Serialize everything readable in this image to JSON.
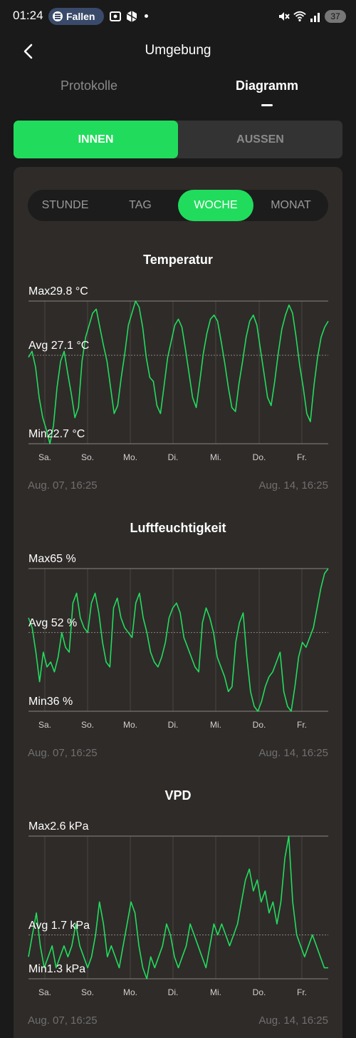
{
  "status_bar": {
    "time": "01:24",
    "media_app": "Fallen",
    "battery": "37"
  },
  "header": {
    "title": "Umgebung",
    "back_icon": "chevron-left-icon"
  },
  "tabs": [
    {
      "label": "Protokolle",
      "active": false
    },
    {
      "label": "Diagramm",
      "active": true
    }
  ],
  "location_toggle": [
    {
      "label": "INNEN",
      "active": true
    },
    {
      "label": "AUSSEN",
      "active": false
    }
  ],
  "time_range": [
    {
      "label": "STUNDE",
      "active": false
    },
    {
      "label": "TAG",
      "active": false
    },
    {
      "label": "WOCHE",
      "active": true
    },
    {
      "label": "MONAT",
      "active": false
    }
  ],
  "colors": {
    "accent": "#21dc5c",
    "background": "#1a1a1a",
    "card": "#2f2b29"
  },
  "chart_data": [
    {
      "type": "line",
      "title": "Temperatur",
      "max_label": "Max29.8 °C",
      "avg_label": "Avg 27.1 °C",
      "min_label": "Min22.7 °C",
      "ylim": [
        22.7,
        29.8
      ],
      "avg": 27.1,
      "x_tick_labels": [
        "Sa.",
        "So.",
        "Mo.",
        "Di.",
        "Mi.",
        "Do.",
        "Fr."
      ],
      "start_label": "Aug. 07, 16:25",
      "end_label": "Aug. 14, 16:25",
      "series": [
        {
          "values": [
            27.0,
            27.3,
            26.5,
            25.0,
            24.0,
            23.4,
            22.7,
            23.6,
            25.5,
            26.8,
            27.3,
            26.2,
            25.2,
            24.0,
            24.5,
            26.8,
            28.0,
            28.6,
            29.2,
            29.4,
            28.5,
            27.6,
            26.8,
            25.5,
            24.2,
            24.6,
            26.0,
            27.2,
            28.6,
            29.2,
            29.8,
            29.5,
            28.5,
            27.0,
            26.0,
            25.8,
            24.6,
            24.2,
            25.6,
            27.0,
            27.8,
            28.6,
            28.9,
            28.5,
            27.4,
            26.2,
            25.0,
            24.5,
            25.8,
            27.2,
            28.2,
            28.9,
            29.1,
            28.8,
            27.8,
            26.7,
            25.5,
            24.5,
            24.3,
            25.7,
            26.8,
            28.0,
            28.8,
            29.1,
            28.6,
            27.4,
            26.2,
            25.0,
            24.6,
            25.8,
            27.2,
            28.4,
            29.1,
            29.6,
            29.2,
            28.0,
            26.6,
            25.5,
            24.2,
            23.8,
            25.6,
            27.0,
            28.0,
            28.5,
            28.8
          ]
        }
      ]
    },
    {
      "type": "line",
      "title": "Luftfeuchtigkeit",
      "max_label": "Max65 %",
      "avg_label": "Avg 52 %",
      "min_label": "Min36 %",
      "ylim": [
        36,
        65
      ],
      "avg": 52,
      "x_tick_labels": [
        "Sa.",
        "So.",
        "Mo.",
        "Di.",
        "Mi.",
        "Do.",
        "Fr."
      ],
      "start_label": "Aug. 07, 16:25",
      "end_label": "Aug. 14, 16:25",
      "series": [
        {
          "values": [
            55,
            53,
            48,
            42,
            48,
            45,
            46,
            44,
            47,
            52,
            49,
            48,
            58,
            60,
            55,
            53,
            52,
            58,
            60,
            56,
            50,
            46,
            45,
            57,
            59,
            55,
            53,
            52,
            51,
            58,
            60,
            55,
            52,
            48,
            46,
            45,
            47,
            50,
            55,
            57,
            58,
            56,
            51,
            49,
            47,
            45,
            44,
            54,
            57,
            55,
            52,
            47,
            45,
            43,
            40,
            41,
            50,
            54,
            56,
            47,
            40,
            37,
            36,
            38,
            41,
            43,
            44,
            46,
            48,
            40,
            37,
            36,
            41,
            47,
            50,
            49,
            51,
            53,
            57,
            61,
            64,
            65
          ]
        }
      ]
    },
    {
      "type": "line",
      "title": "VPD",
      "max_label": "Max2.6 kPa",
      "avg_label": "Avg 1.7 kPa",
      "min_label": "Min1.3 kPa",
      "ylim": [
        1.3,
        2.6
      ],
      "avg": 1.7,
      "x_tick_labels": [
        "Sa.",
        "So.",
        "Mo.",
        "Di.",
        "Mi.",
        "Do.",
        "Fr."
      ],
      "start_label": "Aug. 07, 16:25",
      "end_label": "Aug. 14, 16:25",
      "series": [
        {
          "values": [
            1.5,
            1.7,
            1.9,
            1.6,
            1.4,
            1.5,
            1.6,
            1.4,
            1.5,
            1.6,
            1.5,
            1.6,
            1.8,
            1.6,
            1.5,
            1.4,
            1.5,
            1.7,
            2.0,
            1.8,
            1.5,
            1.6,
            1.5,
            1.4,
            1.6,
            1.8,
            2.0,
            1.9,
            1.6,
            1.4,
            1.3,
            1.5,
            1.4,
            1.5,
            1.6,
            1.8,
            1.7,
            1.5,
            1.4,
            1.5,
            1.6,
            1.8,
            1.7,
            1.6,
            1.5,
            1.4,
            1.6,
            1.8,
            1.7,
            1.8,
            1.7,
            1.6,
            1.7,
            1.8,
            2.0,
            2.2,
            2.3,
            2.1,
            2.2,
            2.0,
            2.1,
            1.9,
            2.0,
            1.8,
            2.0,
            2.4,
            2.6,
            2.0,
            1.7,
            1.6,
            1.5,
            1.6,
            1.7,
            1.6,
            1.5,
            1.4,
            1.4
          ]
        }
      ]
    }
  ]
}
